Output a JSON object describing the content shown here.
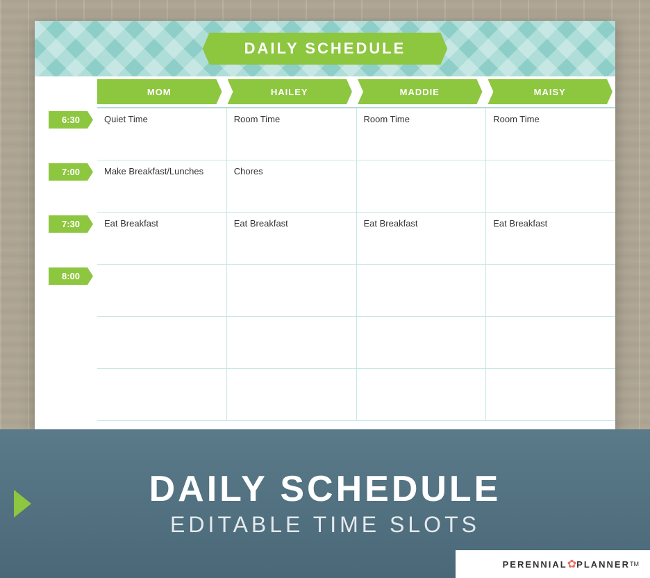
{
  "header": {
    "title": "DAILY SCHEDULE",
    "chevron_color": "#8dcfc8",
    "banner_color": "#8dc63f"
  },
  "columns": [
    {
      "label": "MOM"
    },
    {
      "label": "HAILEY"
    },
    {
      "label": "MADDIE"
    },
    {
      "label": "MAISY"
    }
  ],
  "time_slots": [
    {
      "time": "6:30",
      "cells": [
        "Quiet Time",
        "Room Time",
        "Room Time",
        "Room Time"
      ]
    },
    {
      "time": "7:00",
      "cells": [
        "Make Breakfast/Lunches",
        "Chores",
        "",
        ""
      ]
    },
    {
      "time": "7:30",
      "cells": [
        "Eat Breakfast",
        "Eat Breakfast",
        "Eat Breakfast",
        "Eat Breakfast"
      ]
    },
    {
      "time": "8:00",
      "cells": [
        "",
        "",
        "",
        ""
      ]
    },
    {
      "time": "",
      "cells": [
        "",
        "",
        "",
        ""
      ]
    },
    {
      "time": "",
      "cells": [
        "",
        "",
        "",
        ""
      ]
    }
  ],
  "bottom": {
    "main_title": "DAILY SCHEDULE",
    "subtitle": "EDITABLE TIME SLOTS"
  },
  "branding": {
    "text": "PERENNIAL",
    "text2": "PLANNER",
    "tm": "TM"
  }
}
